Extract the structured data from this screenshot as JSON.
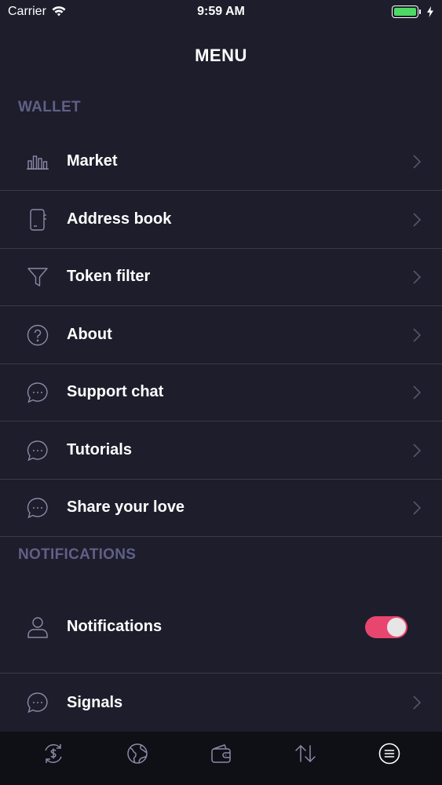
{
  "status_bar": {
    "carrier": "Carrier",
    "time": "9:59 AM"
  },
  "header": {
    "title": "MENU"
  },
  "sections": {
    "wallet": {
      "title": "WALLET",
      "items": [
        {
          "label": "Market",
          "icon": "bar-chart-icon"
        },
        {
          "label": "Address book",
          "icon": "address-book-icon"
        },
        {
          "label": "Token filter",
          "icon": "filter-icon"
        },
        {
          "label": "About",
          "icon": "question-icon"
        },
        {
          "label": "Support chat",
          "icon": "chat-icon"
        },
        {
          "label": "Tutorials",
          "icon": "chat-icon"
        },
        {
          "label": "Share your love",
          "icon": "chat-icon"
        }
      ]
    },
    "notifications": {
      "title": "NOTIFICATIONS",
      "items": [
        {
          "label": "Notifications",
          "icon": "user-icon",
          "toggle": true
        },
        {
          "label": "Signals",
          "icon": "chat-icon"
        }
      ]
    }
  },
  "tab_bar": {
    "items": [
      {
        "icon": "exchange-dollar-icon"
      },
      {
        "icon": "globe-icon"
      },
      {
        "icon": "wallet-icon"
      },
      {
        "icon": "transfer-arrows-icon"
      },
      {
        "icon": "menu-icon",
        "active": true
      }
    ]
  },
  "colors": {
    "background": "#1d1d2b",
    "section_header": "#5f6087",
    "divider": "#3a3a4c",
    "toggle_on": "#e8466f",
    "tab_bar": "#0f0f16",
    "icon": "#8a8aa8"
  }
}
